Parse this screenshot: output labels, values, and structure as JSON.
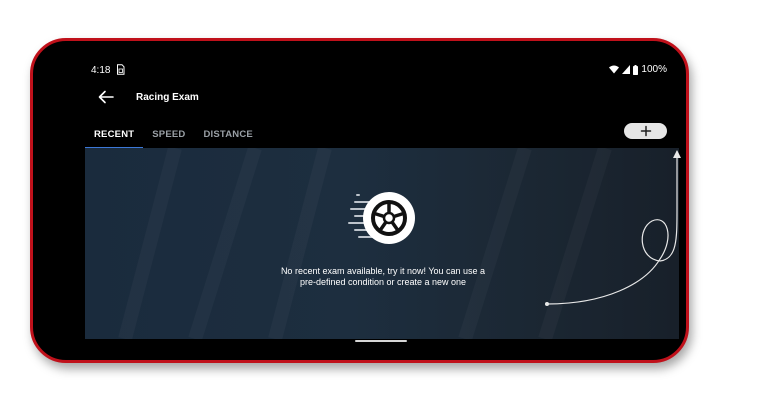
{
  "status_bar": {
    "time": "4:18",
    "battery": "100%"
  },
  "app_bar": {
    "title": "Racing Exam"
  },
  "tabs": [
    {
      "label": "RECENT",
      "active": true
    },
    {
      "label": "SPEED",
      "active": false
    },
    {
      "label": "DISTANCE",
      "active": false
    }
  ],
  "empty_state": {
    "message": "No recent exam available, try it now! You can use a pre-defined condition or create a new one"
  },
  "colors": {
    "frame": "#c0111b",
    "tab_indicator": "#3c78d8",
    "background": "#000000",
    "content_bg": "#1a2b3d"
  },
  "icons": [
    "back-arrow",
    "sim-card",
    "wifi",
    "signal",
    "battery",
    "plus",
    "wheel",
    "curved-arrow"
  ]
}
